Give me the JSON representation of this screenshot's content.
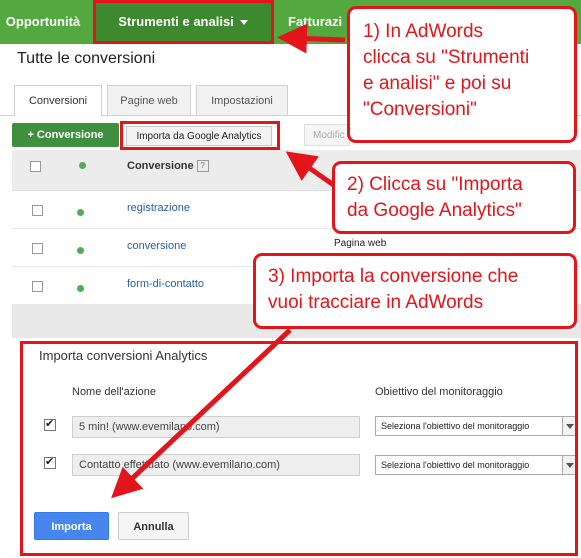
{
  "nav": {
    "items": [
      "Opportunità",
      "Strumenti e analisi",
      "Fatturazi"
    ]
  },
  "page": {
    "title": "Tutte le conversioni"
  },
  "tabs": [
    "Conversioni",
    "Pagine web",
    "Impostazioni"
  ],
  "toolbar": {
    "add_label": "Conversione",
    "import_label": "Importa da Google Analytics",
    "modify_label": "Modific"
  },
  "table": {
    "header_conversion": "Conversione",
    "help": "?",
    "rows": [
      "registrazione",
      "conversione",
      "form-di-contatto"
    ],
    "partial_cell": "Pagina web"
  },
  "import_panel": {
    "title": "Importa conversioni Analytics",
    "col_name": "Nome dell'azione",
    "col_goal": "Obiettivo del monitoraggio",
    "rows": [
      {
        "name": "5 min! (www.evemilano.com)",
        "goal_placeholder": "Seleziona l'obiettivo del monitoraggio",
        "checked": true
      },
      {
        "name": "Contatto effettuato (www.evemilano.com)",
        "goal_placeholder": "Seleziona l'obiettivo del monitoraggio",
        "checked": true
      }
    ],
    "import_button": "Importa",
    "cancel_button": "Annulla"
  },
  "annotations": {
    "step1": [
      "1) In AdWords",
      "clicca su \"Strumenti",
      "e analisi\" e poi su",
      "\"Conversioni\""
    ],
    "step2": [
      "2) Clicca su \"Importa",
      "da Google Analytics\""
    ],
    "step3": [
      "3) Importa la conversione che",
      "vuoi tracciare in AdWords"
    ]
  },
  "colors": {
    "nav_green": "#53a93f",
    "annotation_red": "#e4141b",
    "primary_blue": "#4787ed"
  }
}
